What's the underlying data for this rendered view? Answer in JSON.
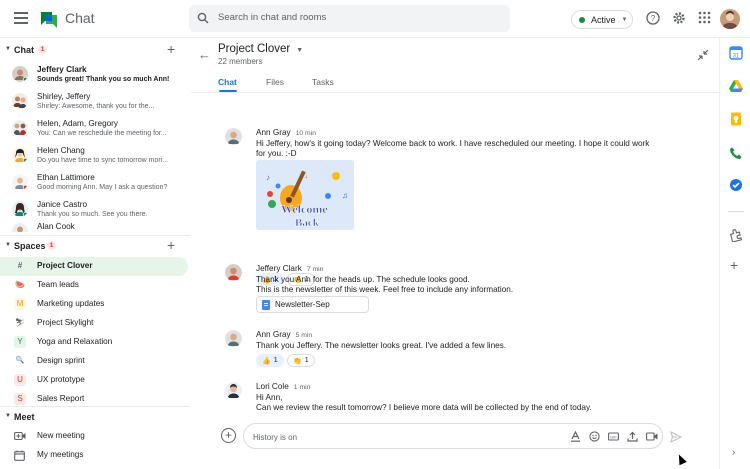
{
  "app": {
    "name": "Chat"
  },
  "search": {
    "placeholder": "Search in chat and rooms"
  },
  "status": {
    "label": "Active"
  },
  "sidebar": {
    "chat_section": {
      "label": "Chat",
      "badge": "1"
    },
    "dms": [
      {
        "name": "Jeffery Clark",
        "preview": "Sounds great! Thank you so much Ann!",
        "unread": true
      },
      {
        "name": "Shirley, Jeffery",
        "preview": "Shirley: Awesome, thank you for the..."
      },
      {
        "name": "Helen, Adam, Gregory",
        "preview": "You: Can we reschedule the meeting for..."
      },
      {
        "name": "Helen Chang",
        "preview": "Do you have time to sync tomorrow mori..."
      },
      {
        "name": "Ethan Lattimore",
        "preview": "Good morning Ann. May I ask a question?"
      },
      {
        "name": "Janice Castro",
        "preview": "Thank you so much. See you there."
      },
      {
        "name": "Alan Cook",
        "preview": ""
      }
    ],
    "spaces_section": {
      "label": "Spaces",
      "badge": "1"
    },
    "spaces": [
      {
        "name": "Project Clover",
        "icon": "#",
        "selected": true
      },
      {
        "name": "Team leads",
        "icon": "🍉"
      },
      {
        "name": "Marketing updates",
        "icon": "M"
      },
      {
        "name": "Project Skylight",
        "icon": "⛷"
      },
      {
        "name": "Yoga and Relaxation",
        "icon": "Y"
      },
      {
        "name": "Design sprint",
        "icon": "🔍"
      },
      {
        "name": "UX prototype",
        "icon": "U"
      },
      {
        "name": "Sales Report",
        "icon": "S"
      }
    ],
    "meet_section": {
      "label": "Meet"
    },
    "meet": [
      {
        "name": "New meeting",
        "icon": "video-plus-icon"
      },
      {
        "name": "My meetings",
        "icon": "calendar-icon"
      }
    ]
  },
  "room": {
    "title": "Project Clover",
    "members": "22 members",
    "tabs": [
      "Chat",
      "Files",
      "Tasks"
    ]
  },
  "messages": [
    {
      "author": "Ann Gray",
      "time": "10 min",
      "lines": [
        "Hi Jeffery, how's it going today? Welcome back to work. I have rescheduled our meeting. I hope it could work",
        "for you. :-D"
      ],
      "image_text": [
        "Welcome",
        "Back"
      ],
      "reactions": [
        {
          "emoji": "👍",
          "count": "1"
        },
        {
          "emoji": "👏",
          "count": "1"
        }
      ]
    },
    {
      "author": "Jeffery Clark",
      "time": "7 min",
      "lines": [
        "Thank you Ann for the heads up. The schedule looks good.",
        "This is the newsletter of this week. Feel free to include any information."
      ],
      "attachment": "Newsletter-Sep"
    },
    {
      "author": "Ann Gray",
      "time": "5 min",
      "lines": [
        "Thank you Jeffery. The newsletter looks great. I've added a few lines."
      ],
      "reactions": [
        {
          "emoji": "👍",
          "count": "1"
        },
        {
          "emoji": "👏",
          "count": "1"
        }
      ]
    },
    {
      "author": "Lori Cole",
      "time": "1 min",
      "lines": [
        "Hi Ann,",
        "Can we review the result tomorrow? I believe more data will be collected by the end of today."
      ]
    }
  ],
  "composer": {
    "placeholder": "History is on"
  }
}
